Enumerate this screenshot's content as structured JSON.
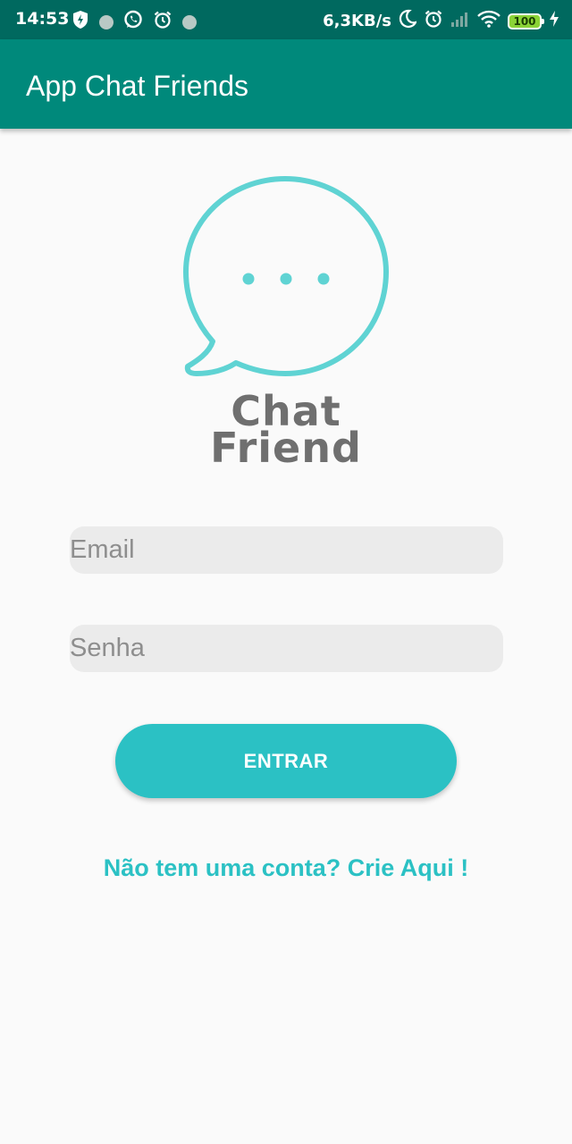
{
  "status_bar": {
    "time": "14:53",
    "net_speed": "6,3KB/s",
    "battery": "100",
    "icons": [
      "shield-bolt-icon",
      "notification-dot-icon",
      "whatsapp-icon",
      "alarm-icon",
      "notification-dot-icon",
      "moon-icon",
      "alarm-icon",
      "signal-icon",
      "wifi-icon",
      "battery-icon",
      "charging-icon"
    ]
  },
  "app_bar": {
    "title": "App Chat Friends",
    "color": "#00897b"
  },
  "logo": {
    "line1": "Chat",
    "line2": "Friend",
    "accent": "#5fd3d3"
  },
  "login_form": {
    "email_placeholder": "Email",
    "email_value": "",
    "password_placeholder": "Senha",
    "password_value": "",
    "submit_label": "ENTRAR",
    "signup_link": "Não tem uma conta? Crie Aqui !"
  },
  "colors": {
    "accent": "#2bc1c4",
    "status_bar": "#00695f",
    "field_bg": "#ebebeb"
  }
}
